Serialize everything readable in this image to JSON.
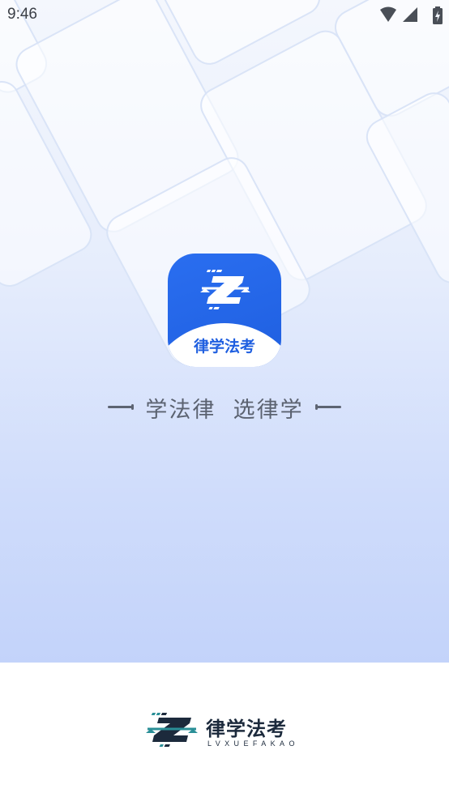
{
  "status_bar": {
    "time": "9:46",
    "icons": [
      "wifi-icon",
      "signal-icon",
      "battery-charging-icon"
    ]
  },
  "app_icon": {
    "title": "律学法考",
    "colors": {
      "primary": "#1f5fe0",
      "white": "#ffffff"
    }
  },
  "slogan": {
    "text": "学法律  选律学"
  },
  "footer_logo": {
    "name_cn": "律学法考",
    "name_en": "LVXUEFAKAO",
    "colors": {
      "dark": "#1c2a3c",
      "teal": "#2a8f97"
    }
  }
}
